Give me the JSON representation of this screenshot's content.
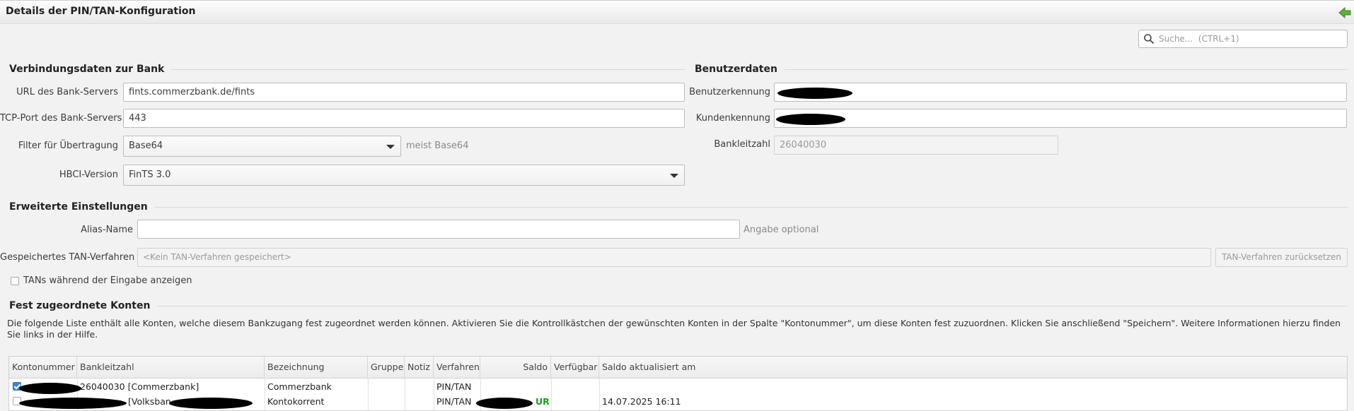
{
  "window": {
    "title": "Details der PIN/TAN-Konfiguration"
  },
  "search": {
    "placeholder": "Suche...  (CTRL+1)"
  },
  "bank_section": {
    "title": "Verbindungsdaten zur Bank",
    "url_label": "URL des Bank-Servers",
    "url_value": "fints.commerzbank.de/fints",
    "port_label": "TCP-Port des Bank-Servers",
    "port_value": "443",
    "filter_label": "Filter für Übertragung",
    "filter_value": "Base64",
    "filter_hint": "meist Base64",
    "hbci_label": "HBCI-Version",
    "hbci_value": "FinTS 3.0"
  },
  "user_section": {
    "title": "Benutzerdaten",
    "user_label": "Benutzerkennung",
    "customer_label": "Kundenkennung",
    "blz_label": "Bankleitzahl",
    "blz_value": "26040030"
  },
  "advanced_section": {
    "title": "Erweiterte Einstellungen",
    "alias_label": "Alias-Name",
    "alias_hint": "Angabe optional",
    "tan_label": "Gespeichertes TAN-Verfahren",
    "tan_placeholder": "<Kein TAN-Verfahren gespeichert>",
    "tan_reset_button": "TAN-Verfahren zurücksetzen",
    "show_tans_label": "TANs während der Eingabe anzeigen"
  },
  "accounts_section": {
    "title": "Fest zugeordnete Konten",
    "description": "Die folgende Liste enthält alle Konten, welche diesem Bankzugang fest zugeordnet werden können. Aktivieren Sie die Kontrollkästchen der gewünschten Konten in der Spalte \"Kontonummer\", um diese Konten fest zuzuordnen. Klicken Sie anschließend \"Speichern\". Weitere Informationen hierzu finden Sie links in der Hilfe."
  },
  "table": {
    "columns": [
      "Kontonummer",
      "Bankleitzahl",
      "Bezeichnung",
      "Gruppe",
      "Notiz",
      "Verfahren",
      "Saldo",
      "Verfügbar",
      "Saldo aktualisiert am"
    ],
    "rows": [
      {
        "checked": true,
        "bankleitzahl": "26040030 [Commerzbank]",
        "bezeichnung": "Commerzbank",
        "verfahren": "PIN/TAN",
        "saldo_suffix": "",
        "aktualisiert": ""
      },
      {
        "checked": false,
        "bankleitzahl": "[Volksban",
        "bezeichnung": "Kontokorrent",
        "verfahren": "PIN/TAN",
        "saldo_suffix": "UR",
        "aktualisiert": "14.07.2025 16:11"
      }
    ]
  },
  "colors": {
    "accent": "#3b85d8",
    "positive": "#1a9a1a"
  }
}
